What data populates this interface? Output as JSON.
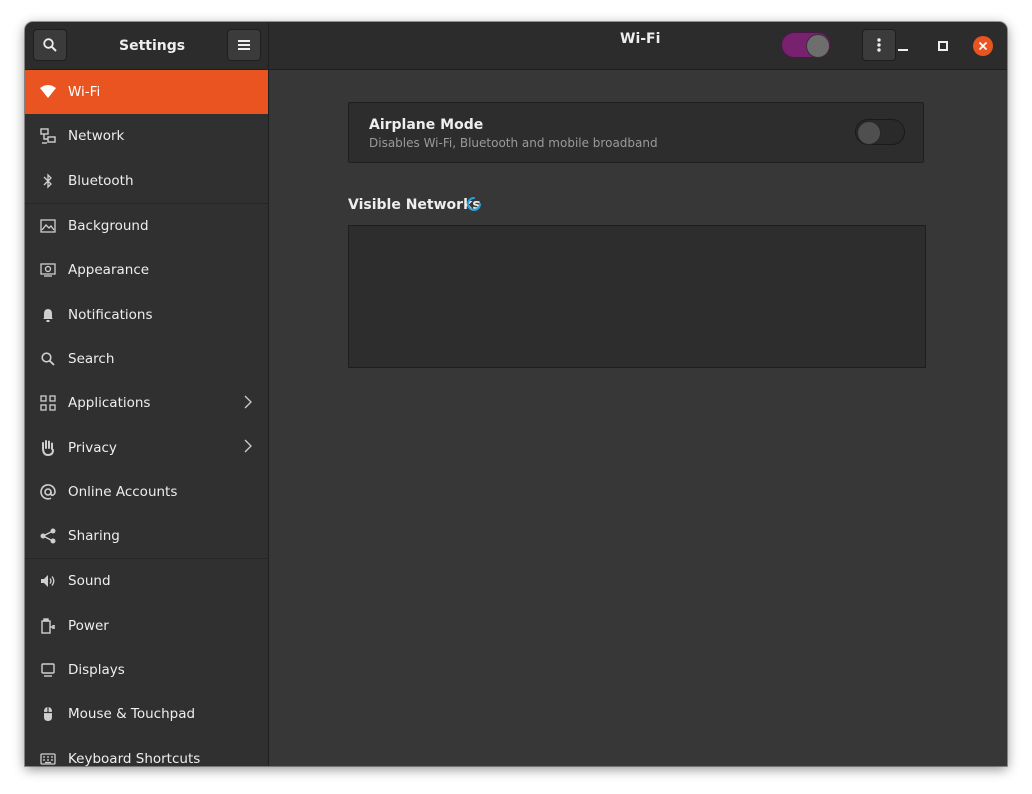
{
  "window": {
    "sidebar_title": "Settings",
    "page_title": "Wi-Fi"
  },
  "header": {
    "wifi_toggle_on": true,
    "icons": [
      "search-icon",
      "hamburger-menu-icon",
      "kebab-menu-icon",
      "minimize-icon",
      "maximize-icon",
      "close-icon"
    ]
  },
  "sidebar": {
    "items": [
      {
        "label": "Wi-Fi",
        "icon": "wifi-icon",
        "active": true
      },
      {
        "label": "Network",
        "icon": "network-icon"
      },
      {
        "label": "Bluetooth",
        "icon": "bluetooth-icon"
      },
      {
        "label": "Background",
        "icon": "background-icon"
      },
      {
        "label": "Appearance",
        "icon": "appearance-icon"
      },
      {
        "label": "Notifications",
        "icon": "bell-icon"
      },
      {
        "label": "Search",
        "icon": "search-icon"
      },
      {
        "label": "Applications",
        "icon": "applications-icon",
        "has_submenu": true
      },
      {
        "label": "Privacy",
        "icon": "hand-icon",
        "has_submenu": true
      },
      {
        "label": "Online Accounts",
        "icon": "at-icon"
      },
      {
        "label": "Sharing",
        "icon": "share-icon"
      },
      {
        "label": "Sound",
        "icon": "speaker-icon"
      },
      {
        "label": "Power",
        "icon": "power-icon"
      },
      {
        "label": "Displays",
        "icon": "display-icon"
      },
      {
        "label": "Mouse & Touchpad",
        "icon": "mouse-icon"
      },
      {
        "label": "Keyboard Shortcuts",
        "icon": "keyboard-icon"
      }
    ]
  },
  "airplane": {
    "title": "Airplane Mode",
    "subtitle": "Disables Wi-Fi, Bluetooth and mobile broadband",
    "enabled": false
  },
  "networks": {
    "title": "Visible Networks",
    "loading": true
  },
  "colors": {
    "accent": "#e95420",
    "toggle_on": "#77216f",
    "spinner": "#2a9fd6",
    "close_button": "#e95420"
  }
}
